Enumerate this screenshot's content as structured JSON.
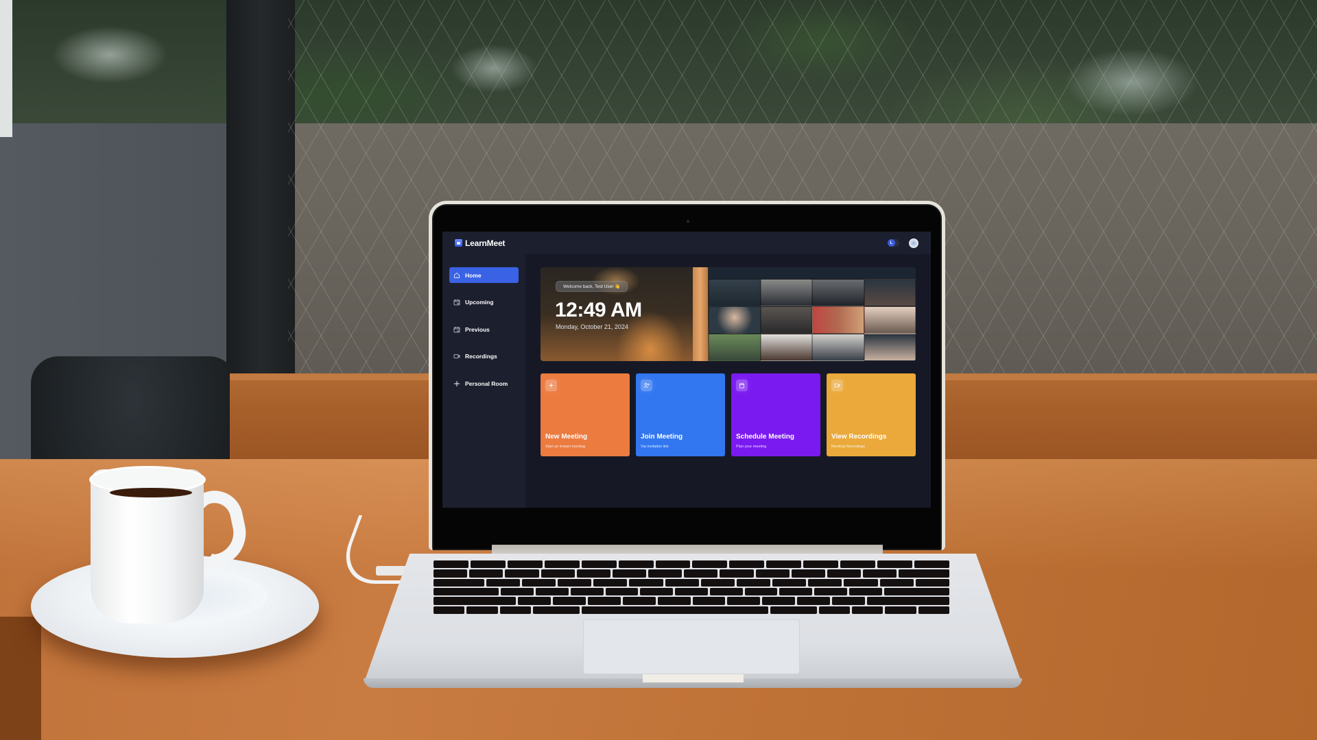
{
  "app": {
    "name": "LearnMeet",
    "brand_color": "#3a62e4"
  },
  "header": {
    "user_initial": "L",
    "avatar_icon": "user-avatar-icon"
  },
  "sidebar": {
    "items": [
      {
        "label": "Home",
        "icon": "home-icon",
        "active": true
      },
      {
        "label": "Upcoming",
        "icon": "calendar-forward-icon",
        "active": false
      },
      {
        "label": "Previous",
        "icon": "calendar-back-icon",
        "active": false
      },
      {
        "label": "Recordings",
        "icon": "video-icon",
        "active": false
      },
      {
        "label": "Personal Room",
        "icon": "plus-icon",
        "active": false
      }
    ]
  },
  "hero": {
    "welcome": "Welcome back, Test User 👋",
    "time": "12:49 AM",
    "date": "Monday, October 21, 2024"
  },
  "cards": [
    {
      "title": "New Meeting",
      "subtitle": "Start an instant meeting",
      "icon": "plus-icon",
      "color": "#ec7b40"
    },
    {
      "title": "Join Meeting",
      "subtitle": "Via invitation link",
      "icon": "user-add-icon",
      "color": "#3276f0"
    },
    {
      "title": "Schedule Meeting",
      "subtitle": "Plan your meeting",
      "icon": "calendar-icon",
      "color": "#7a1af0"
    },
    {
      "title": "View Recordings",
      "subtitle": "Meeting Recordings",
      "icon": "video-icon",
      "color": "#eaa93a"
    }
  ]
}
